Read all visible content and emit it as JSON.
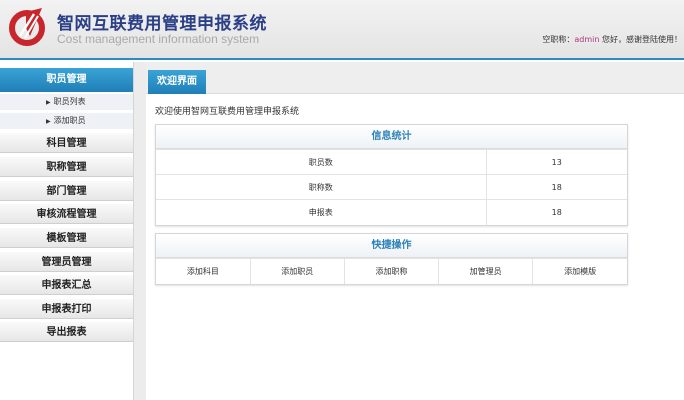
{
  "header": {
    "title": "智网互联费用管理申报系统",
    "subtitle": "Cost management information system",
    "welcome_prefix": "空职称：",
    "user": "admin",
    "welcome_suffix": " 您好，感谢登陆使用！"
  },
  "sidebar": {
    "active_group": "职员管理",
    "sub_items": [
      {
        "label": "职员列表"
      },
      {
        "label": "添加职员"
      }
    ],
    "groups": [
      {
        "label": "科目管理"
      },
      {
        "label": "职称管理"
      },
      {
        "label": "部门管理"
      },
      {
        "label": "审核流程管理"
      },
      {
        "label": "模板管理"
      },
      {
        "label": "管理员管理"
      },
      {
        "label": "申报表汇总"
      },
      {
        "label": "申报表打印"
      },
      {
        "label": "导出报表"
      }
    ]
  },
  "main": {
    "tab": "欢迎界面",
    "intro": "欢迎使用智网互联费用管理申报系统",
    "stats": {
      "title": "信息统计",
      "rows": [
        {
          "label": "职员数",
          "value": "13"
        },
        {
          "label": "职称数",
          "value": "18"
        },
        {
          "label": "申报表",
          "value": "18"
        }
      ]
    },
    "quick": {
      "title": "快捷操作",
      "actions": [
        {
          "label": "添加科目"
        },
        {
          "label": "添加职员"
        },
        {
          "label": "添加职称"
        },
        {
          "label": "加管理员"
        },
        {
          "label": "添加模版"
        }
      ]
    }
  },
  "colors": {
    "accent": "#2d8bbf",
    "brand": "#2a3f86",
    "logo_red": "#c8252c"
  }
}
